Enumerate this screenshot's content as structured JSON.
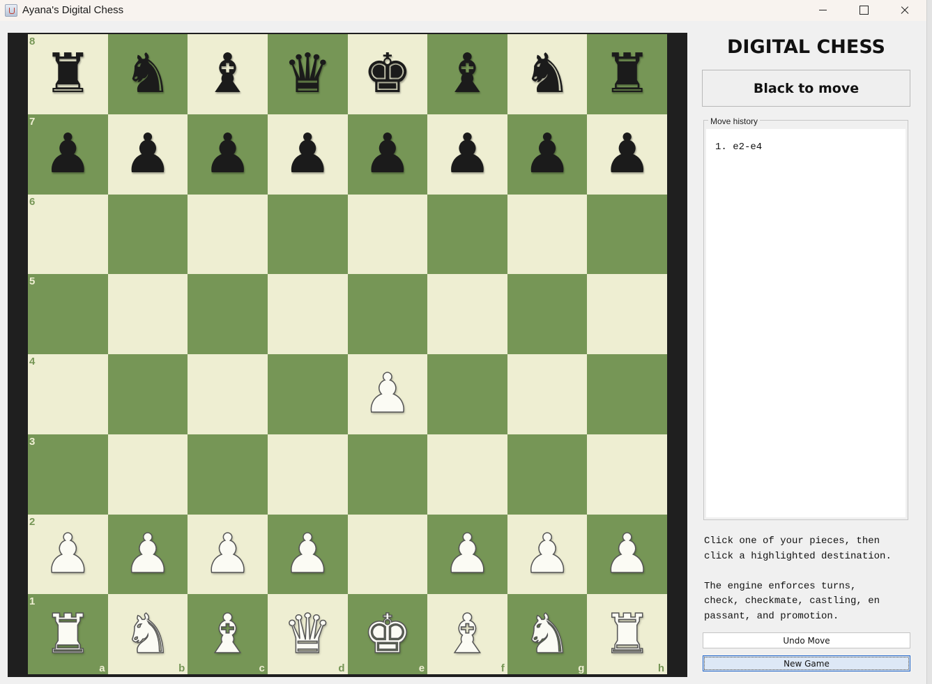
{
  "window": {
    "title": "Ayana's Digital Chess",
    "controls": [
      "minimize",
      "maximize",
      "close"
    ]
  },
  "board": {
    "light_color": "#eeeed2",
    "dark_color": "#769656",
    "rank_labels": [
      "8",
      "7",
      "6",
      "5",
      "4",
      "3",
      "2",
      "1"
    ],
    "file_labels": [
      "a",
      "b",
      "c",
      "d",
      "e",
      "f",
      "g",
      "h"
    ],
    "rows": [
      [
        "bR",
        "bN",
        "bB",
        "bQ",
        "bK",
        "bB",
        "bN",
        "bR"
      ],
      [
        "bP",
        "bP",
        "bP",
        "bP",
        "bP",
        "bP",
        "bP",
        "bP"
      ],
      [
        "",
        "",
        "",
        "",
        "",
        "",
        "",
        ""
      ],
      [
        "",
        "",
        "",
        "",
        "",
        "",
        "",
        ""
      ],
      [
        "",
        "",
        "",
        "",
        "wP",
        "",
        "",
        ""
      ],
      [
        "",
        "",
        "",
        "",
        "",
        "",
        "",
        ""
      ],
      [
        "wP",
        "wP",
        "wP",
        "wP",
        "",
        "wP",
        "wP",
        "wP"
      ],
      [
        "wR",
        "wN",
        "wB",
        "wQ",
        "wK",
        "wB",
        "wN",
        "wR"
      ]
    ]
  },
  "side_panel": {
    "title": "DIGITAL CHESS",
    "status": "Black to move",
    "history_label": "Move history",
    "moves": [
      "1. e2-e4"
    ],
    "help_text": "Click one of your pieces, then\nclick a highlighted destination.\n\nThe engine enforces turns,\ncheck, checkmate, castling, en\npassant, and promotion.",
    "undo_label": "Undo Move",
    "new_game_label": "New Game"
  }
}
